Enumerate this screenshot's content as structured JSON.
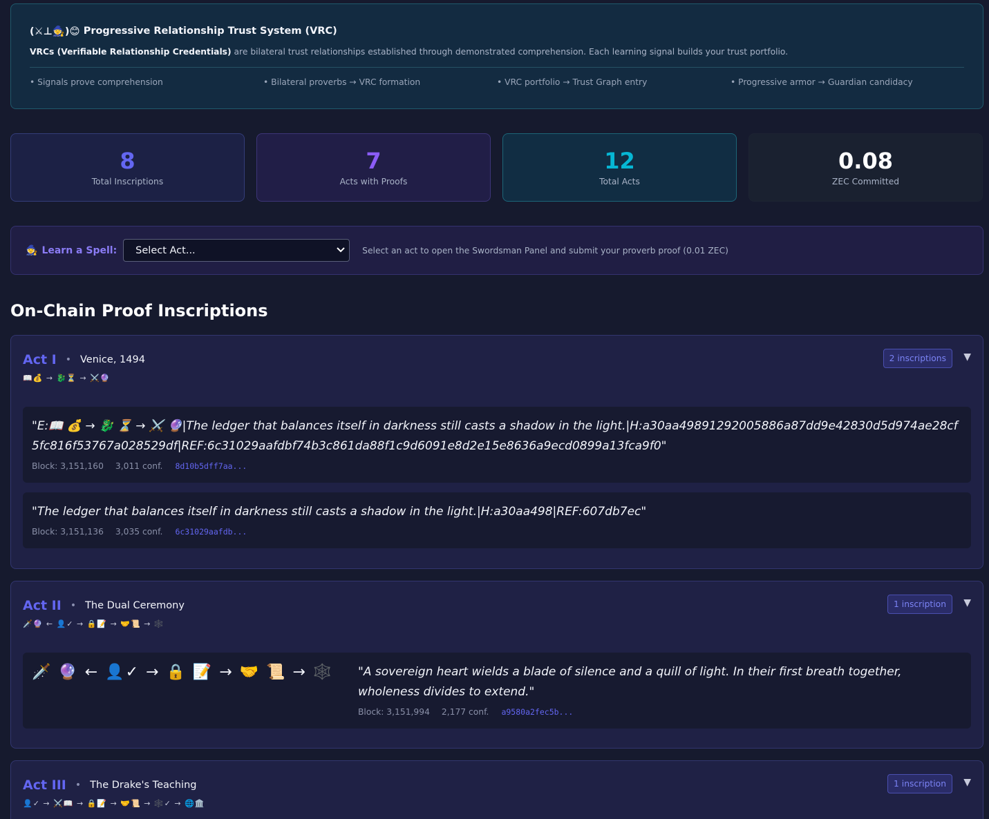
{
  "vrc": {
    "glyph": "(⚔⊥🧙)😊",
    "title": "Progressive Relationship Trust System (VRC)",
    "desc_bold": "VRCs (Verifiable Relationship Credentials)",
    "desc_rest": " are bilateral trust relationships established through demonstrated comprehension. Each learning signal builds your trust portfolio.",
    "points": [
      "• Signals prove comprehension",
      "• Bilateral proverbs → VRC formation",
      "• VRC portfolio → Trust Graph entry",
      "• Progressive armor → Guardian candidacy"
    ]
  },
  "stats": [
    {
      "value": "8",
      "label": "Total Inscriptions",
      "color": "#6366f1"
    },
    {
      "value": "7",
      "label": "Acts with Proofs",
      "color": "#8b5cf6"
    },
    {
      "value": "12",
      "label": "Total Acts",
      "color": "#06b6d4"
    },
    {
      "value": "0.08",
      "label": "ZEC Committed",
      "color": "#ffffff"
    }
  ],
  "spell": {
    "icon": "🧙",
    "label": "Learn a Spell:",
    "select_value": "Select Act...",
    "hint": "Select an act to open the Swordsman Panel and submit your proverb proof (0.01 ZEC)"
  },
  "section_title": "On-Chain Proof Inscriptions",
  "acts": [
    {
      "title": "Act I",
      "subtitle": "Venice, 1494",
      "badge": "2 inscriptions",
      "emoji": "📖💰 → 🐉⏳ → ⚔️🔮",
      "inscriptions": [
        {
          "text": "\"E:📖 💰 → 🐉 ⏳ → ⚔️ 🔮|The ledger that balances itself in darkness still casts a shadow in the light.|H:a30aa49891292005886a87dd9e42830d5d974ae28cf5fc816f53767a028529df|REF:6c31029aafdbf74b3c861da88f1c9d6091e8d2e15e8636a9ecd0899a13fca9f0\"",
          "block": "Block: 3,151,160",
          "conf": "3,011 conf.",
          "hash": "8d10b5dff7aa..."
        },
        {
          "text": "\"The ledger that balances itself in darkness still casts a shadow in the light.|H:a30aa498|REF:607db7ec\"",
          "block": "Block: 3,151,136",
          "conf": "3,035 conf.",
          "hash": "6c31029aafdb..."
        }
      ]
    },
    {
      "title": "Act II",
      "subtitle": "The Dual Ceremony",
      "badge": "1 inscription",
      "emoji": "🗡️🔮 ← 👤✓ → 🔒📝 → 🤝📜 → 🕸️",
      "inscriptions": [
        {
          "emoji": "🗡️ 🔮 ← 👤✓ → 🔒 📝 → 🤝 📜 → 🕸️",
          "text": "\"A sovereign heart wields a blade of silence and a quill of light. In their first breath together, wholeness divides to extend.\"",
          "block": "Block: 3,151,994",
          "conf": "2,177 conf.",
          "hash": "a9580a2fec5b..."
        }
      ]
    },
    {
      "title": "Act III",
      "subtitle": "The Drake's Teaching",
      "badge": "1 inscription",
      "emoji": "👤✓ → ⚔️📖 → 🔒📝 → 🤝📜 → 🕸️✓ → 🌐🏛️"
    }
  ],
  "toggle_icon": "▼"
}
